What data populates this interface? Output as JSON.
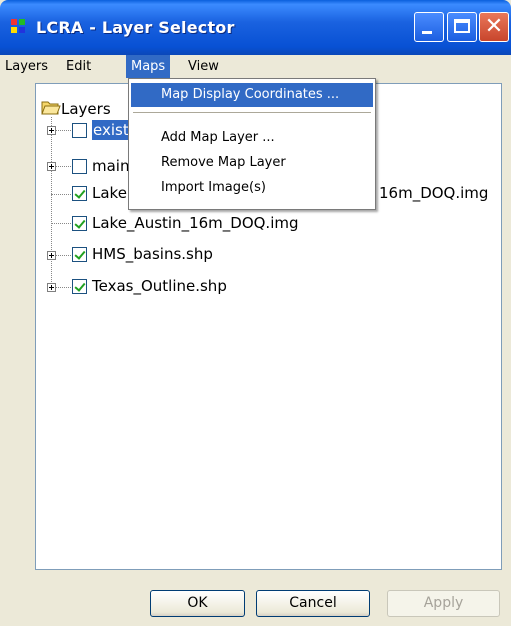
{
  "window": {
    "title": "LCRA - Layer Selector"
  },
  "menubar": {
    "items": [
      "Layers",
      "Edit",
      "Maps",
      "View"
    ]
  },
  "maps_menu": {
    "items": [
      "Map Display Coordinates ...",
      "Add Map Layer ...",
      "Remove Map Layer",
      "Import Image(s)"
    ]
  },
  "tree": {
    "root": "Layers",
    "items": [
      {
        "label": "exist",
        "checked": false,
        "expandable": true,
        "selected": true
      },
      {
        "label": "main",
        "checked": false,
        "expandable": true
      },
      {
        "label": "Lake",
        "suffix": "16m_DOQ.img",
        "checked": true,
        "expandable": false
      },
      {
        "label": "Lake_Austin_16m_DOQ.img",
        "checked": true,
        "expandable": false
      },
      {
        "label": "HMS_basins.shp",
        "checked": true,
        "expandable": true
      },
      {
        "label": "Texas_Outline.shp",
        "checked": true,
        "expandable": true
      }
    ]
  },
  "buttons": {
    "ok": "OK",
    "cancel": "Cancel",
    "apply": "Apply"
  },
  "colors": {
    "selection": "#316ac5",
    "titlebar": "#0851d4",
    "check": "#21a121"
  },
  "icons": [
    "app-grid-icon",
    "minimize-icon",
    "maximize-icon",
    "close-icon",
    "folder-open-icon",
    "expand-icon",
    "checkbox-icon"
  ]
}
